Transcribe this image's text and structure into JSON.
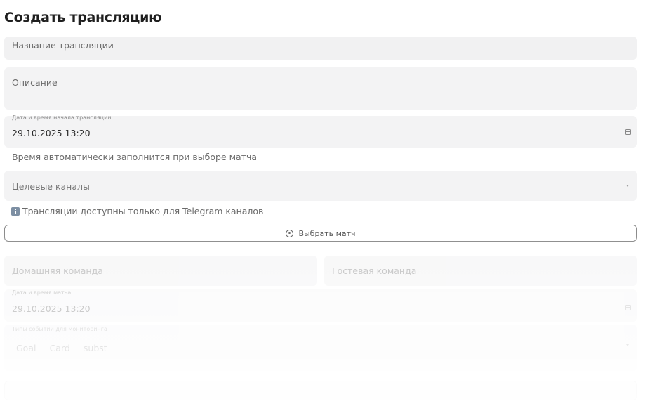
{
  "title": "Создать трансляцию",
  "form": {
    "name_placeholder": "Название трансляции",
    "description_placeholder": "Описание",
    "start_label": "Дата и время начала трансляции",
    "start_value": "29.10.2025 13:20",
    "start_hint": "Время автоматически заполнится при выборе матча",
    "channels_placeholder": "Целевые каналы",
    "channels_note": "Трансляции доступны только для Telegram каналов",
    "select_match_label": "Выбрать матч",
    "home_team_placeholder": "Домашняя команда",
    "away_team_placeholder": "Гостевая команда",
    "match_time_label": "Дата и время матча",
    "match_time_value": "29.10.2025 13:20",
    "event_types_label": "Типы событий для мониторинга",
    "event_types": [
      "Goal",
      "Card",
      "subst"
    ]
  }
}
